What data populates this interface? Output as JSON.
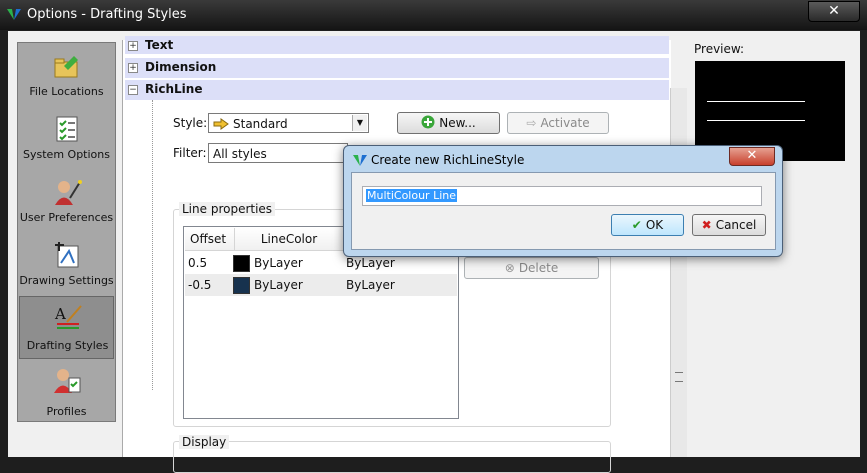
{
  "window": {
    "title": "Options - Drafting Styles",
    "close_glyph": "✕"
  },
  "nav": [
    {
      "label": "File Locations",
      "icon": "folder-arrow-icon",
      "selected": false
    },
    {
      "label": "System Options",
      "icon": "checklist-icon",
      "selected": false
    },
    {
      "label": "User Preferences",
      "icon": "user-wand-icon",
      "selected": false
    },
    {
      "label": "Drawing Settings",
      "icon": "drawing-settings-icon",
      "selected": false
    },
    {
      "label": "Drafting Styles",
      "icon": "drafting-styles-icon",
      "selected": true
    },
    {
      "label": "Profiles",
      "icon": "profile-user-icon",
      "selected": false
    }
  ],
  "tree": {
    "items": [
      {
        "label": "Text",
        "expander": "+"
      },
      {
        "label": "Dimension",
        "expander": "+"
      },
      {
        "label": "RichLine",
        "expander": "−"
      }
    ]
  },
  "richline": {
    "style_label": "Style:",
    "style_value": "Standard",
    "filter_label": "Filter:",
    "filter_value": "All styles",
    "new_button": "New...",
    "activate_button": "Activate",
    "delete_button": "Delete",
    "line_properties_title": "Line properties",
    "display_title": "Display",
    "table": {
      "headers": [
        "Offset",
        "LineColor",
        ""
      ],
      "rows": [
        {
          "offset": "0.5",
          "color_name": "ByLayer",
          "linetype": "ByLayer",
          "swatch": "#000000"
        },
        {
          "offset": "-0.5",
          "color_name": "ByLayer",
          "linetype": "ByLayer",
          "swatch": "#17324e"
        }
      ]
    }
  },
  "preview": {
    "label": "Preview:"
  },
  "dialog": {
    "title": "Create new RichLineStyle",
    "input_value": "MultiColour Line",
    "ok_button": "OK",
    "cancel_button": "Cancel",
    "close_glyph": "✕"
  },
  "colors": {
    "nav_bg": "#a7a7a7",
    "tree_header": "#dcdff8",
    "dialog_frame": "#bcd6ee"
  }
}
